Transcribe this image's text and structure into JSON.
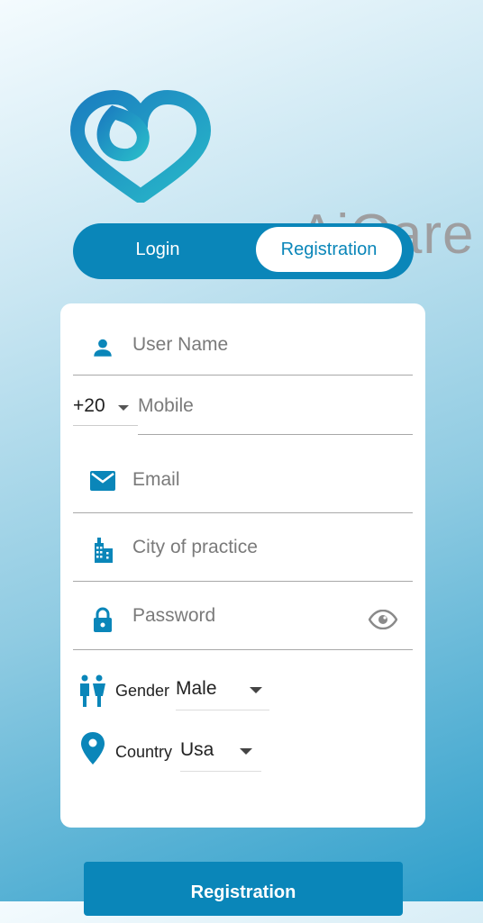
{
  "brand": {
    "name": "AiCare"
  },
  "tabs": {
    "login": "Login",
    "registration": "Registration"
  },
  "form": {
    "username_placeholder": "User Name",
    "country_code": "+20",
    "mobile_placeholder": "Mobile",
    "email_placeholder": "Email",
    "city_placeholder": "City of practice",
    "password_placeholder": "Password",
    "gender_label": "Gender",
    "gender_value": "Male",
    "country_label": "Country",
    "country_value": "Usa"
  },
  "submit_label": "Registration",
  "colors": {
    "accent": "#0a86b9",
    "brand_gray": "#9e9ea0"
  }
}
